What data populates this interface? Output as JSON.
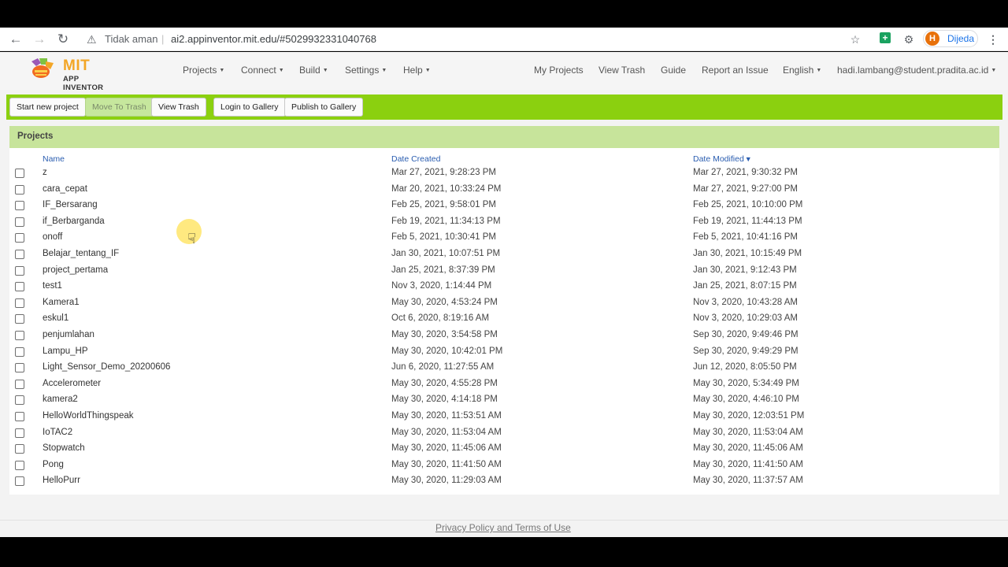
{
  "browser": {
    "security_label": "Tidak aman",
    "url": "ai2.appinventor.mit.edu/#5029932331040768",
    "profile_initial": "H",
    "profile_label": "Dijeda",
    "icons": [
      "back-icon",
      "forward-icon",
      "reload-icon",
      "warning-icon",
      "star-icon",
      "extension-icon",
      "puzzle-icon",
      "menu-icon"
    ]
  },
  "app": {
    "logo": {
      "title": "MIT",
      "subtitle": "APP INVENTOR"
    },
    "menus": [
      "Projects",
      "Connect",
      "Build",
      "Settings",
      "Help"
    ],
    "links": [
      "My Projects",
      "View Trash",
      "Guide",
      "Report an Issue",
      "English",
      "hadi.lambang@student.pradita.ac.id"
    ],
    "toolbar": {
      "start_new": "Start new project",
      "move_to_trash": "Move To Trash",
      "view_trash": "View Trash",
      "login_gallery": "Login to Gallery",
      "publish_gallery": "Publish to Gallery"
    },
    "colors": {
      "toolbar_bg": "#8bd00f",
      "panel_head_bg": "#c7e49b",
      "link": "#2a5db0"
    },
    "projects": {
      "heading": "Projects",
      "columns": {
        "name": "Name",
        "created": "Date Created",
        "modified": "Date Modified",
        "sort_indicator": "▼"
      },
      "rows": [
        [
          "z",
          "Mar 27, 2021, 9:28:23 PM",
          "Mar 27, 2021, 9:30:32 PM"
        ],
        [
          "cara_cepat",
          "Mar 20, 2021, 10:33:24 PM",
          "Mar 27, 2021, 9:27:00 PM"
        ],
        [
          "IF_Bersarang",
          "Feb 25, 2021, 9:58:01 PM",
          "Feb 25, 2021, 10:10:00 PM"
        ],
        [
          "if_Berbarganda",
          "Feb 19, 2021, 11:34:13 PM",
          "Feb 19, 2021, 11:44:13 PM"
        ],
        [
          "onoff",
          "Feb 5, 2021, 10:30:41 PM",
          "Feb 5, 2021, 10:41:16 PM"
        ],
        [
          "Belajar_tentang_IF",
          "Jan 30, 2021, 10:07:51 PM",
          "Jan 30, 2021, 10:15:49 PM"
        ],
        [
          "project_pertama",
          "Jan 25, 2021, 8:37:39 PM",
          "Jan 30, 2021, 9:12:43 PM"
        ],
        [
          "test1",
          "Nov 3, 2020, 1:14:44 PM",
          "Jan 25, 2021, 8:07:15 PM"
        ],
        [
          "Kamera1",
          "May 30, 2020, 4:53:24 PM",
          "Nov 3, 2020, 10:43:28 AM"
        ],
        [
          "eskul1",
          "Oct 6, 2020, 8:19:16 AM",
          "Nov 3, 2020, 10:29:03 AM"
        ],
        [
          "penjumlahan",
          "May 30, 2020, 3:54:58 PM",
          "Sep 30, 2020, 9:49:46 PM"
        ],
        [
          "Lampu_HP",
          "May 30, 2020, 10:42:01 PM",
          "Sep 30, 2020, 9:49:29 PM"
        ],
        [
          "Light_Sensor_Demo_20200606",
          "Jun 6, 2020, 11:27:55 AM",
          "Jun 12, 2020, 8:05:50 PM"
        ],
        [
          "Accelerometer",
          "May 30, 2020, 4:55:28 PM",
          "May 30, 2020, 5:34:49 PM"
        ],
        [
          "kamera2",
          "May 30, 2020, 4:14:18 PM",
          "May 30, 2020, 4:46:10 PM"
        ],
        [
          "HelloWorldThingspeak",
          "May 30, 2020, 11:53:51 AM",
          "May 30, 2020, 12:03:51 PM"
        ],
        [
          "IoTAC2",
          "May 30, 2020, 11:53:04 AM",
          "May 30, 2020, 11:53:04 AM"
        ],
        [
          "Stopwatch",
          "May 30, 2020, 11:45:06 AM",
          "May 30, 2020, 11:45:06 AM"
        ],
        [
          "Pong",
          "May 30, 2020, 11:41:50 AM",
          "May 30, 2020, 11:41:50 AM"
        ],
        [
          "HelloPurr",
          "May 30, 2020, 11:29:03 AM",
          "May 30, 2020, 11:37:57 AM"
        ]
      ]
    },
    "footer": "Privacy Policy and Terms of Use"
  }
}
